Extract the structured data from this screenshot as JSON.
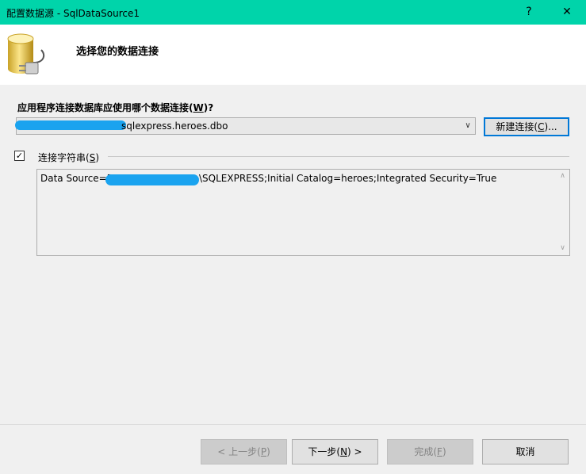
{
  "window": {
    "title": "配置数据源 - SqlDataSource1",
    "help_label": "?",
    "close_label": "✕"
  },
  "header": {
    "title": "选择您的数据连接",
    "icon": "database-plug-icon"
  },
  "connection": {
    "question_prefix": "应用程序连接数据库应使用哪个数据连接(",
    "question_key": "W",
    "question_suffix": ")?",
    "selected_value": "sqlexpress.heroes.dbo",
    "new_button_prefix": "新建连接(",
    "new_button_key": "C",
    "new_button_suffix": ")..."
  },
  "conn_string": {
    "checkbox_checked": true,
    "checkbox_mark": "✓",
    "label_prefix": "连接字符串(",
    "label_key": "S",
    "label_suffix": ")",
    "prefix": "Data Source=D",
    "suffix": "\\SQLEXPRESS;Initial Catalog=heroes;Integrated Security=True"
  },
  "footer": {
    "back_prefix": "< 上一步(",
    "back_key": "P",
    "back_suffix": ")",
    "next_prefix": "下一步(",
    "next_key": "N",
    "next_suffix": ") >",
    "finish_prefix": "完成(",
    "finish_key": "F",
    "finish_suffix": ")",
    "cancel_label": "取消"
  },
  "colors": {
    "titlebar": "#00d4aa",
    "accent": "#0078d7",
    "redaction": "#1aa3ef"
  }
}
